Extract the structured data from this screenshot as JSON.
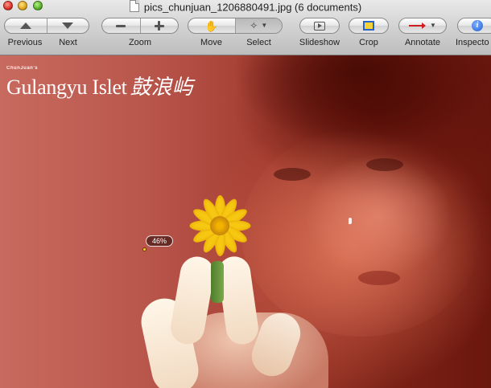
{
  "window": {
    "title": "pics_chunjuan_1206880491.jpg (6 documents)"
  },
  "toolbar": {
    "previous_label": "Previous",
    "next_label": "Next",
    "zoom_label": "Zoom",
    "move_label": "Move",
    "select_label": "Select",
    "slideshow_label": "Slideshow",
    "crop_label": "Crop",
    "annotate_label": "Annotate",
    "inspector_label": "Inspecto"
  },
  "image": {
    "watermark_small": "ChunJuan's",
    "watermark_title": "Gulangyu Islet",
    "watermark_cjk": "鼓浪屿",
    "zoom_badge": "46%"
  },
  "colors": {
    "accent_blue": "#2a62c9",
    "annotate_red": "#cc1e1e",
    "flower_yellow": "#f6c812"
  }
}
